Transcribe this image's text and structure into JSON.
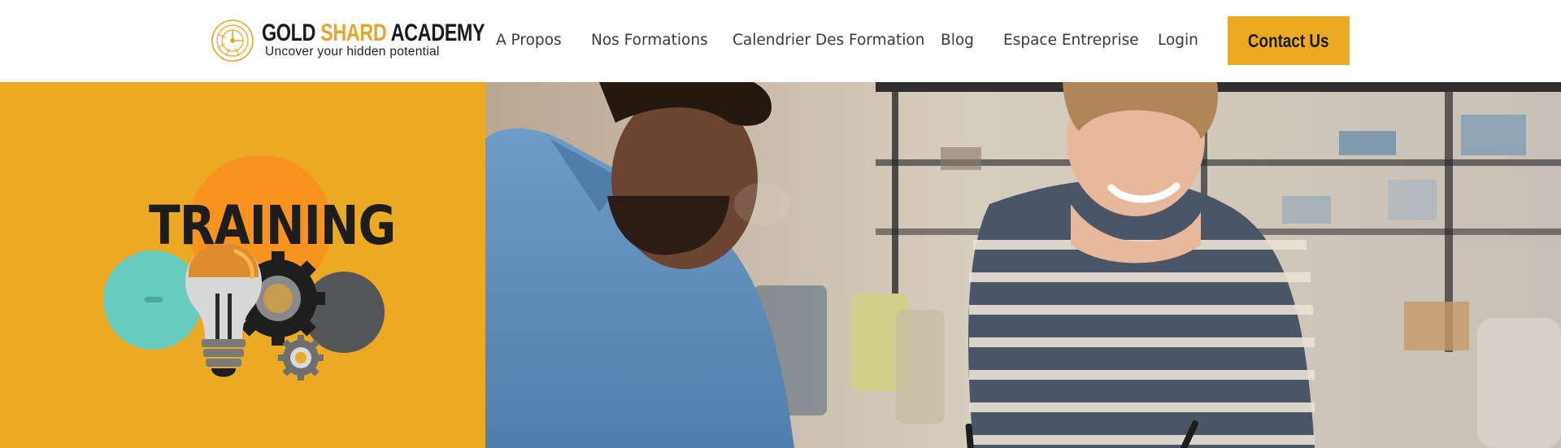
{
  "brand": {
    "name_part1": "GOLD",
    "name_part2": "SHARD",
    "name_part3": "ACADEMY",
    "tagline": "Uncover your hidden potential",
    "accent_color": "#ebaa22"
  },
  "nav": {
    "items": [
      {
        "label": "A Propos"
      },
      {
        "label": "Nos Formations"
      },
      {
        "label": "Calendrier Des Formation"
      },
      {
        "label": "Blog"
      },
      {
        "label": "Espace Entreprise"
      },
      {
        "label": "Login"
      }
    ],
    "cta_label": "Contact Us"
  },
  "hero": {
    "illustration_title": "TRAINING",
    "panel_color": "#ecaa24",
    "illustration_icons": [
      "lightbulb-icon",
      "gear-icon"
    ]
  }
}
